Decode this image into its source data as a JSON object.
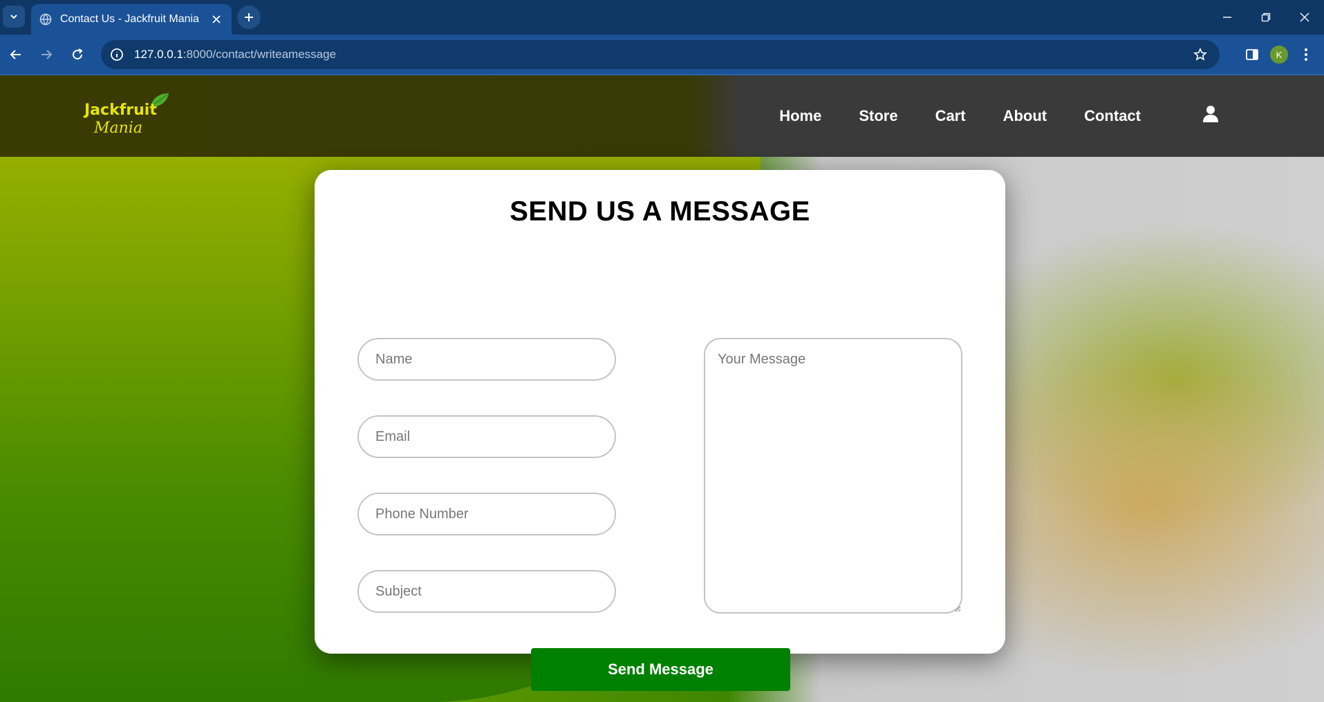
{
  "browser": {
    "tab_title": "Contact Us - Jackfruit Mania",
    "url_host": "127.0.0.1",
    "url_path": ":8000/contact/writeamessage",
    "profile_initial": "K"
  },
  "site": {
    "logo_line1": "Jackfruit",
    "logo_line2": "Mania",
    "nav": [
      "Home",
      "Store",
      "Cart",
      "About",
      "Contact"
    ]
  },
  "form": {
    "title": "SEND US A MESSAGE",
    "name_placeholder": "Name",
    "email_placeholder": "Email",
    "phone_placeholder": "Phone Number",
    "subject_placeholder": "Subject",
    "message_placeholder": "Your Message",
    "submit_label": "Send Message"
  },
  "colors": {
    "tab_active": "#1b5297",
    "header_bg": "#3a3a3a",
    "logo_yellow": "#e6e600",
    "submit_green": "#008000"
  }
}
